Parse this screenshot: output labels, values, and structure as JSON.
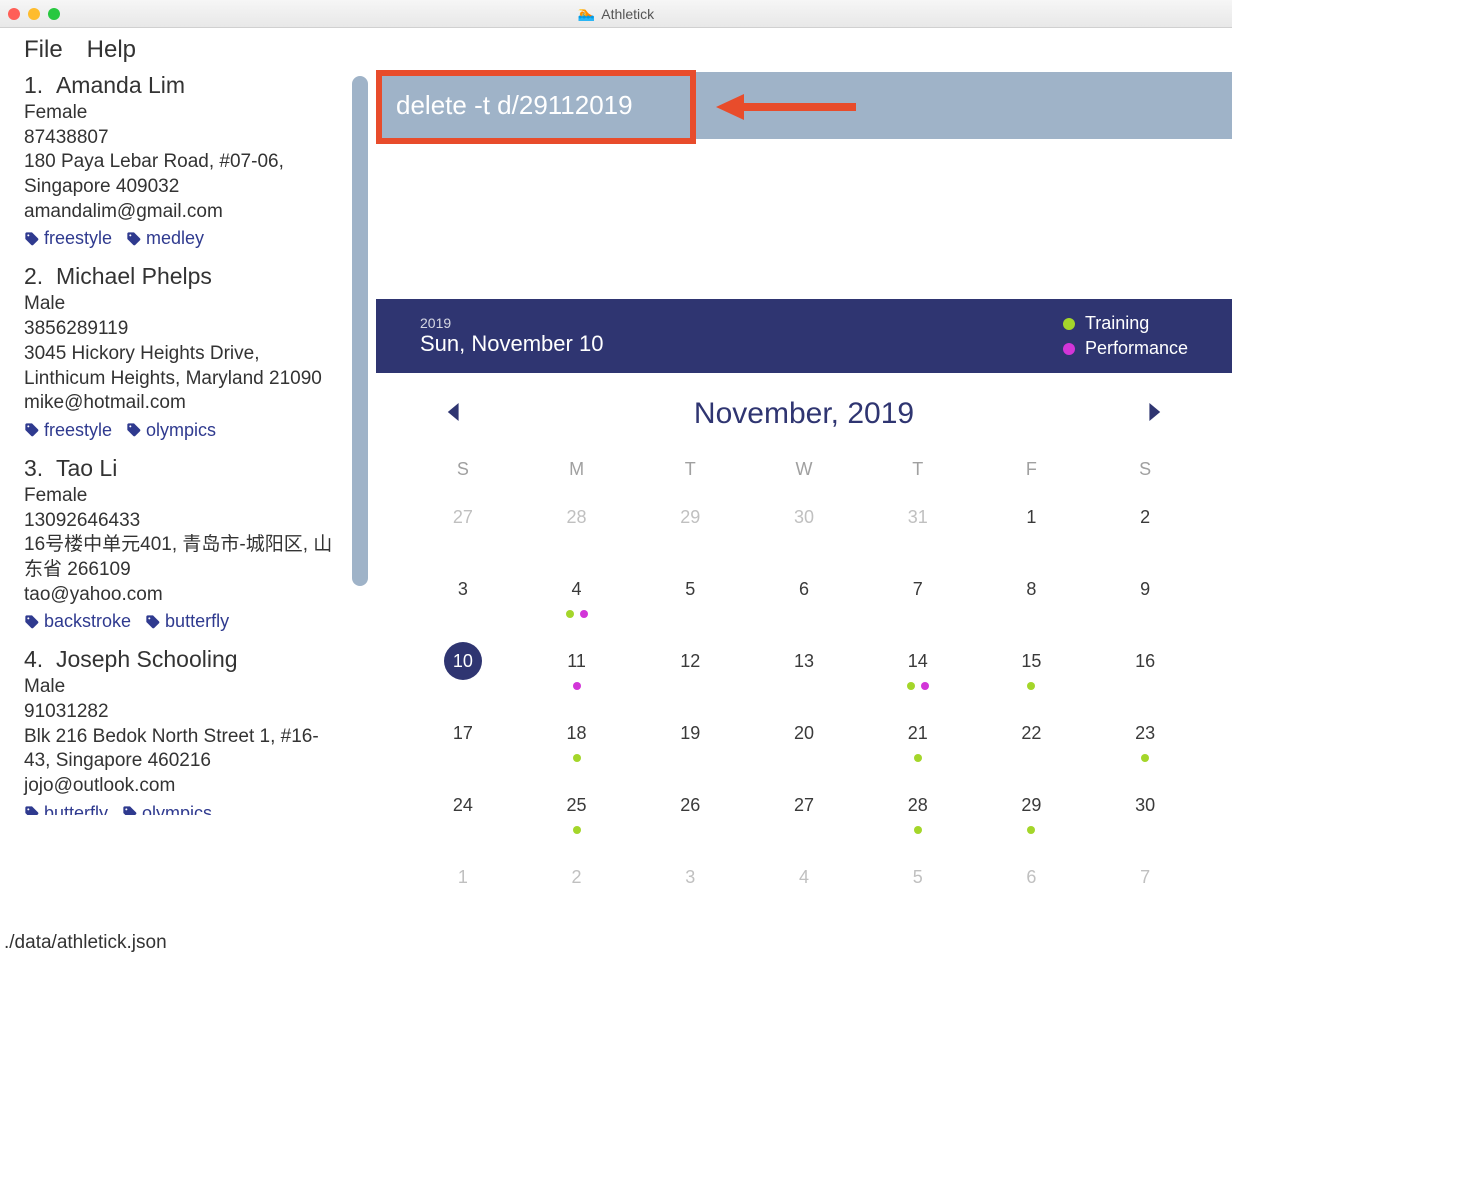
{
  "app_title": "Athletick",
  "menu": {
    "file": "File",
    "help": "Help"
  },
  "command_input": "delete -t d/29112019",
  "people": [
    {
      "index": "1.",
      "name": "Amanda Lim",
      "gender": "Female",
      "phone": "87438807",
      "address": "180 Paya Lebar Road, #07-06, Singapore 409032",
      "email": "amandalim@gmail.com",
      "tags": [
        "freestyle",
        "medley"
      ]
    },
    {
      "index": "2.",
      "name": "Michael Phelps",
      "gender": "Male",
      "phone": "3856289119",
      "address": "3045 Hickory Heights Drive, Linthicum Heights, Maryland 21090",
      "email": "mike@hotmail.com",
      "tags": [
        "freestyle",
        "olympics"
      ]
    },
    {
      "index": "3.",
      "name": "Tao Li",
      "gender": "Female",
      "phone": "13092646433",
      "address": "16号楼中单元401, 青岛市-城阳区, 山东省 266109",
      "email": "tao@yahoo.com",
      "tags": [
        "backstroke",
        "butterfly"
      ]
    },
    {
      "index": "4.",
      "name": "Joseph Schooling",
      "gender": "Male",
      "phone": "91031282",
      "address": "Blk 216 Bedok North Street 1, #16-43, Singapore 460216",
      "email": "jojo@outlook.com",
      "tags": [
        "butterfly",
        "olympics"
      ]
    }
  ],
  "calendar": {
    "year": "2019",
    "date_label": "Sun, November 10",
    "legend": [
      {
        "label": "Training",
        "color": "#a4d62a"
      },
      {
        "label": "Performance",
        "color": "#d235d8"
      }
    ],
    "month_label": "November, 2019",
    "dow": [
      "S",
      "M",
      "T",
      "W",
      "T",
      "F",
      "S"
    ],
    "weeks": [
      [
        {
          "n": "27",
          "muted": true
        },
        {
          "n": "28",
          "muted": true
        },
        {
          "n": "29",
          "muted": true
        },
        {
          "n": "30",
          "muted": true
        },
        {
          "n": "31",
          "muted": true
        },
        {
          "n": "1"
        },
        {
          "n": "2"
        }
      ],
      [
        {
          "n": "3"
        },
        {
          "n": "4",
          "dots": [
            "#a4d62a",
            "#d235d8"
          ]
        },
        {
          "n": "5"
        },
        {
          "n": "6"
        },
        {
          "n": "7"
        },
        {
          "n": "8"
        },
        {
          "n": "9"
        }
      ],
      [
        {
          "n": "10",
          "selected": true
        },
        {
          "n": "11",
          "dots": [
            "#d235d8"
          ]
        },
        {
          "n": "12"
        },
        {
          "n": "13"
        },
        {
          "n": "14",
          "dots": [
            "#a4d62a",
            "#d235d8"
          ]
        },
        {
          "n": "15",
          "dots": [
            "#a4d62a"
          ]
        },
        {
          "n": "16"
        }
      ],
      [
        {
          "n": "17"
        },
        {
          "n": "18",
          "dots": [
            "#a4d62a"
          ]
        },
        {
          "n": "19"
        },
        {
          "n": "20"
        },
        {
          "n": "21",
          "dots": [
            "#a4d62a"
          ]
        },
        {
          "n": "22"
        },
        {
          "n": "23",
          "dots": [
            "#a4d62a"
          ]
        }
      ],
      [
        {
          "n": "24"
        },
        {
          "n": "25",
          "dots": [
            "#a4d62a"
          ]
        },
        {
          "n": "26"
        },
        {
          "n": "27"
        },
        {
          "n": "28",
          "dots": [
            "#a4d62a"
          ]
        },
        {
          "n": "29",
          "dots": [
            "#a4d62a"
          ]
        },
        {
          "n": "30"
        }
      ],
      [
        {
          "n": "1",
          "muted": true
        },
        {
          "n": "2",
          "muted": true
        },
        {
          "n": "3",
          "muted": true
        },
        {
          "n": "4",
          "muted": true
        },
        {
          "n": "5",
          "muted": true
        },
        {
          "n": "6",
          "muted": true
        },
        {
          "n": "7",
          "muted": true
        }
      ]
    ]
  },
  "status_path": "./data/athletick.json"
}
